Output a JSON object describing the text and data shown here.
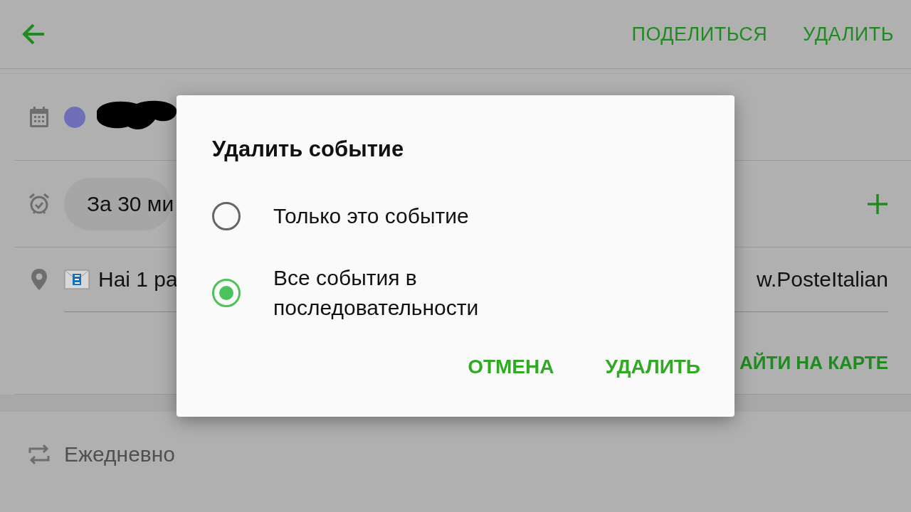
{
  "top_bar": {
    "actions": [
      "ПОДЕЛИТЬСЯ",
      "УДАЛИТЬ"
    ]
  },
  "reminder": {
    "label": "За 30 ми"
  },
  "location": {
    "text": "Hai 1 pa",
    "text_end": "w.PosteItalian",
    "map_link": "АЙТИ НА КАРТЕ"
  },
  "repeat": {
    "label": "Ежедневно"
  },
  "dialog": {
    "title": "Удалить событие",
    "options": [
      {
        "label": "Только это событие",
        "selected": false
      },
      {
        "label": "Все события в последовательности",
        "selected": true
      }
    ],
    "buttons": [
      "ОТМЕНА",
      "УДАЛИТЬ"
    ]
  }
}
